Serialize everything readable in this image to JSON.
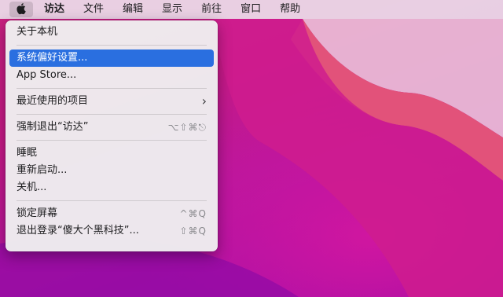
{
  "menubar": {
    "apple_icon": "apple-logo-icon",
    "items": [
      {
        "label": "访达"
      },
      {
        "label": "文件"
      },
      {
        "label": "编辑"
      },
      {
        "label": "显示"
      },
      {
        "label": "前往"
      },
      {
        "label": "窗口"
      },
      {
        "label": "帮助"
      }
    ]
  },
  "apple_menu": {
    "items": [
      {
        "label": "关于本机"
      },
      {
        "label": "系统偏好设置..."
      },
      {
        "label": "App Store..."
      },
      {
        "label": "最近使用的项目",
        "submenu_icon": "chevron-right-icon"
      },
      {
        "label": "强制退出“访达”",
        "shortcut": "⌥⇧⌘⎋"
      },
      {
        "label": "睡眠"
      },
      {
        "label": "重新启动..."
      },
      {
        "label": "关机..."
      },
      {
        "label": "锁定屏幕",
        "shortcut": "^⌘Q"
      },
      {
        "label": "退出登录“傻大个黑科技”...",
        "shortcut": "⇧⌘Q"
      }
    ],
    "selected_index": 1
  },
  "colors": {
    "highlight": "#2a6fe0",
    "menubar_bg": "#ecdeea",
    "desktop_pink": "#e2527a",
    "desktop_magenta": "#b8169c"
  }
}
